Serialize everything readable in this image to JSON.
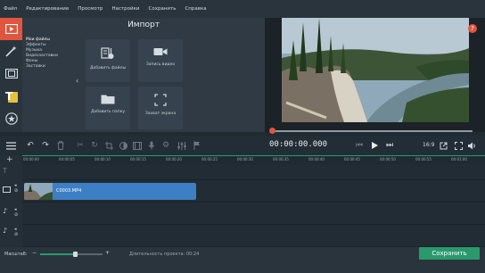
{
  "menu": [
    "Файл",
    "Редактирование",
    "Просмотр",
    "Настройки",
    "Сохранить",
    "Справка"
  ],
  "import": {
    "title": "Импорт",
    "sections": [
      "Мои файлы",
      "Эффекты",
      "Музыка",
      "Видеозаставки",
      "Фоны",
      "Заставки"
    ],
    "tiles": {
      "add_files": "Добавить файлы",
      "record_video": "Запись видео",
      "add_folder": "Добавить папку",
      "screen_record": "Захват экрана"
    }
  },
  "preview": {
    "help_label": "?",
    "timecode": "00:00:00.000",
    "aspect_ratio": "16:9"
  },
  "ruler": {
    "ticks": [
      "00:00:00",
      "00:00:05",
      "00:00:10",
      "00:00:15",
      "00:00:20",
      "00:00:25",
      "00:00:30",
      "00:00:35",
      "00:00:40",
      "00:00:45",
      "00:00:50",
      "00:00:55",
      "00:01:00"
    ]
  },
  "timeline": {
    "clip_name": "C0003.MP4"
  },
  "bottom": {
    "zoom_label": "Масштаб:",
    "zoom_level": 0.55,
    "duration": "Длительность проекта: 00:24",
    "save_label": "Сохранить"
  },
  "colors": {
    "accent": "#e0553f",
    "save": "#2a9a6c",
    "clip": "#3c7fc4"
  }
}
